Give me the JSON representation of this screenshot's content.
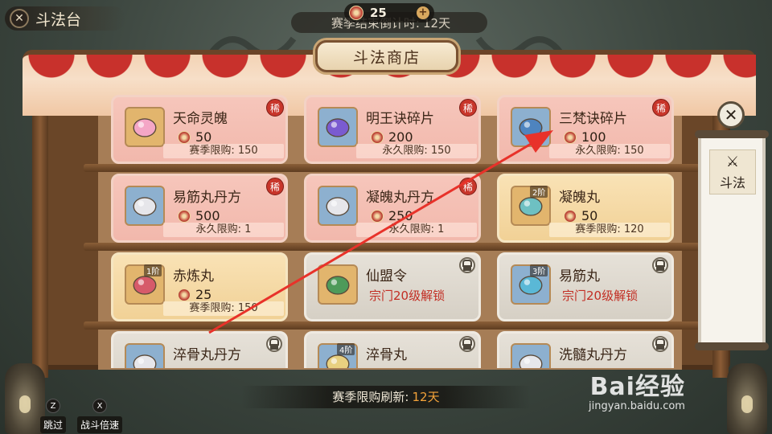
{
  "header": {
    "back_label": "斗法台",
    "currency_amount": "25",
    "season_countdown_label": "赛季结束倒计时:",
    "season_countdown_value": "12天"
  },
  "shop": {
    "title": "斗法商店"
  },
  "items": [
    {
      "name": "天命灵魄",
      "price": "50",
      "limit": "赛季限购: 150",
      "badge": "稀",
      "style": "red",
      "icon": "rainbow-crystal-icon"
    },
    {
      "name": "明王诀碎片",
      "price": "200",
      "limit": "永久限购: 150",
      "badge": "稀",
      "style": "red",
      "icon": "purple-scroll-icon"
    },
    {
      "name": "三梵诀碎片",
      "price": "100",
      "limit": "永久限购: 150",
      "badge": "稀",
      "style": "red",
      "icon": "blue-scroll-icon"
    },
    {
      "name": "易筋丸丹方",
      "price": "500",
      "limit": "永久限购: 1",
      "badge": "稀",
      "style": "red",
      "icon": "recipe-scroll-icon"
    },
    {
      "name": "凝魄丸丹方",
      "price": "250",
      "limit": "永久限购: 1",
      "badge": "稀",
      "style": "red",
      "icon": "recipe-scroll-icon"
    },
    {
      "name": "凝魄丸",
      "price": "50",
      "limit": "赛季限购: 120",
      "tier": "2阶",
      "style": "gold",
      "icon": "pill-tray-icon"
    },
    {
      "name": "赤炼丸",
      "price": "25",
      "limit": "赛季限购: 150",
      "tier": "1阶",
      "style": "gold",
      "icon": "red-pill-icon"
    },
    {
      "name": "仙盟令",
      "locked_text": "宗门20级解锁",
      "style": "gray",
      "icon": "alliance-token-icon"
    },
    {
      "name": "易筋丸",
      "locked_text": "宗门20级解锁",
      "tier": "3阶",
      "style": "gray",
      "icon": "blue-pill-tray-icon"
    },
    {
      "name": "淬骨丸丹方",
      "style": "gray",
      "icon": "recipe-scroll-icon"
    },
    {
      "name": "淬骨丸",
      "tier": "4阶",
      "style": "gray",
      "icon": "bone-pill-icon"
    },
    {
      "name": "洗髓丸丹方",
      "style": "gray",
      "icon": "recipe-scroll-icon"
    }
  ],
  "side": {
    "doufa_label": "斗法"
  },
  "footer": {
    "refresh_label": "赛季限购刷新:",
    "refresh_value": "12天",
    "skip_key": "Z",
    "skip_label": "跳过",
    "speed_key": "X",
    "speed_label": "战斗倍速"
  },
  "watermark": {
    "brand": "Bai经验",
    "url": "jingyan.baidu.com"
  },
  "colors": {
    "rare_badge": "#c8352a",
    "locked_text": "#c22d23",
    "refresh_days": "#f2a23a",
    "annotation_arrow": "#e8322a"
  }
}
